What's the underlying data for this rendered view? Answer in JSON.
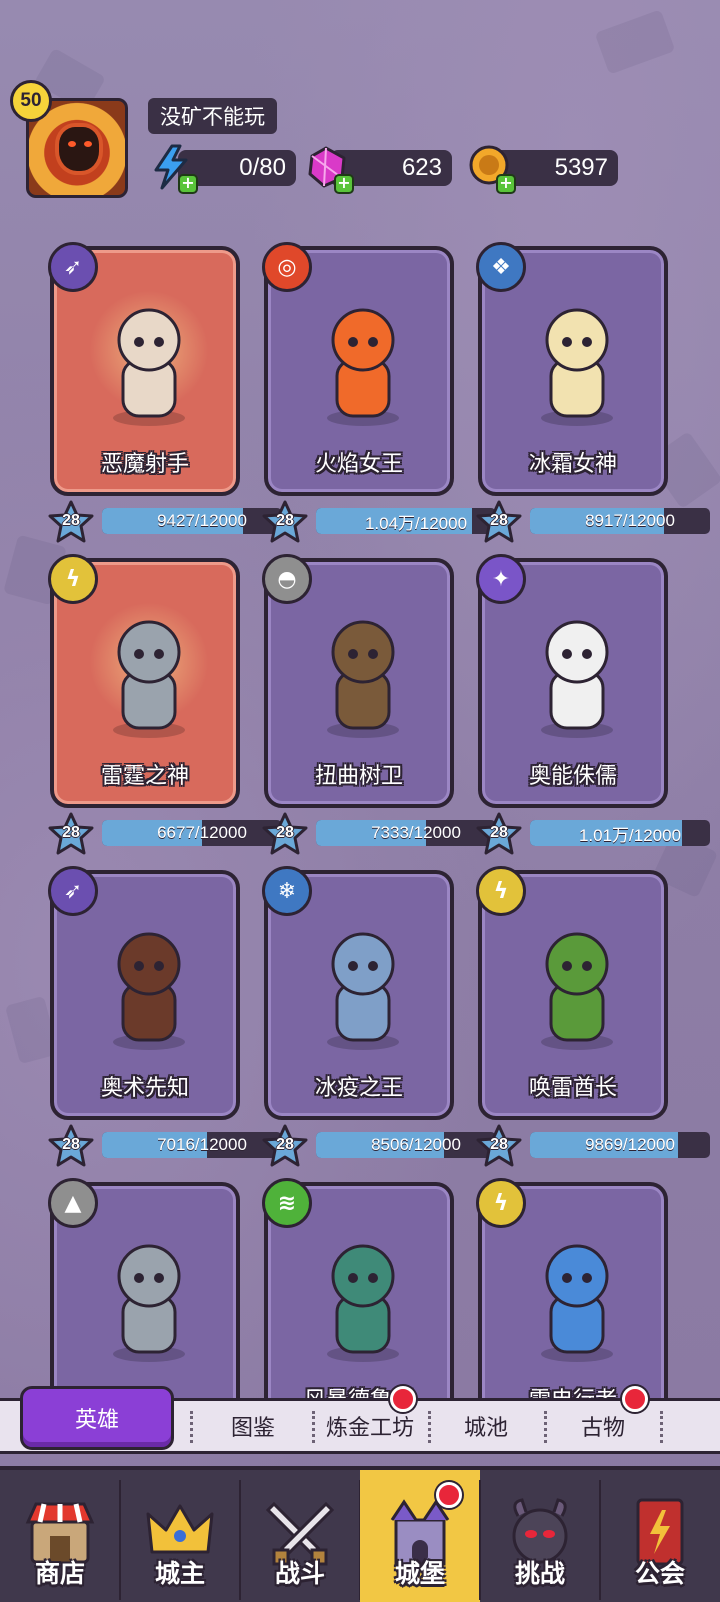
{
  "player": {
    "level": "50",
    "name": "没矿不能玩"
  },
  "resources": {
    "energy": "0/80",
    "gems": "623",
    "gold": "5397"
  },
  "heroes": [
    {
      "name": "恶魔射手",
      "level": "28",
      "progress_text": "9427/12000",
      "progress": 0.786,
      "highlight": true,
      "class_color": "#6b4fb0"
    },
    {
      "name": "火焰女王",
      "level": "28",
      "progress_text": "1.04万/12000",
      "progress": 0.867,
      "highlight": false,
      "class_color": "#e0482a"
    },
    {
      "name": "冰霜女神",
      "level": "28",
      "progress_text": "8917/12000",
      "progress": 0.743,
      "highlight": false,
      "class_color": "#3f78c2"
    },
    {
      "name": "雷霆之神",
      "level": "28",
      "progress_text": "6677/12000",
      "progress": 0.556,
      "highlight": true,
      "class_color": "#e2c23a"
    },
    {
      "name": "扭曲树卫",
      "level": "28",
      "progress_text": "7333/12000",
      "progress": 0.611,
      "highlight": false,
      "class_color": "#8f8f8f"
    },
    {
      "name": "奥能侏儒",
      "level": "28",
      "progress_text": "1.01万/12000",
      "progress": 0.842,
      "highlight": false,
      "class_color": "#7a55c8"
    },
    {
      "name": "奥术先知",
      "level": "28",
      "progress_text": "7016/12000",
      "progress": 0.585,
      "highlight": false,
      "class_color": "#6b4fb0"
    },
    {
      "name": "冰疫之王",
      "level": "28",
      "progress_text": "8506/12000",
      "progress": 0.709,
      "highlight": false,
      "class_color": "#3f78c2"
    },
    {
      "name": "唤雷酋长",
      "level": "28",
      "progress_text": "9869/12000",
      "progress": 0.822,
      "highlight": false,
      "class_color": "#e2c23a"
    },
    {
      "name": "",
      "level": "",
      "progress_text": "",
      "progress": 0,
      "highlight": false,
      "class_color": "#8f8f8f"
    },
    {
      "name": "风暴德鲁伊",
      "level": "",
      "progress_text": "",
      "progress": 0,
      "highlight": false,
      "class_color": "#4fb23a"
    },
    {
      "name": "雷电行者",
      "level": "",
      "progress_text": "",
      "progress": 0,
      "highlight": false,
      "class_color": "#e2c23a"
    }
  ],
  "subtabs": {
    "heroes": "英雄",
    "codex": "图鉴",
    "alchemy": "炼金工坊",
    "city": "城池",
    "relics": "古物"
  },
  "nav": {
    "shop": "商店",
    "lord": "城主",
    "battle": "战斗",
    "castle": "城堡",
    "challenge": "挑战",
    "guild": "公会"
  },
  "icons": {
    "energy": "lightning-icon",
    "gems": "gem-icon",
    "gold": "coin-icon"
  }
}
